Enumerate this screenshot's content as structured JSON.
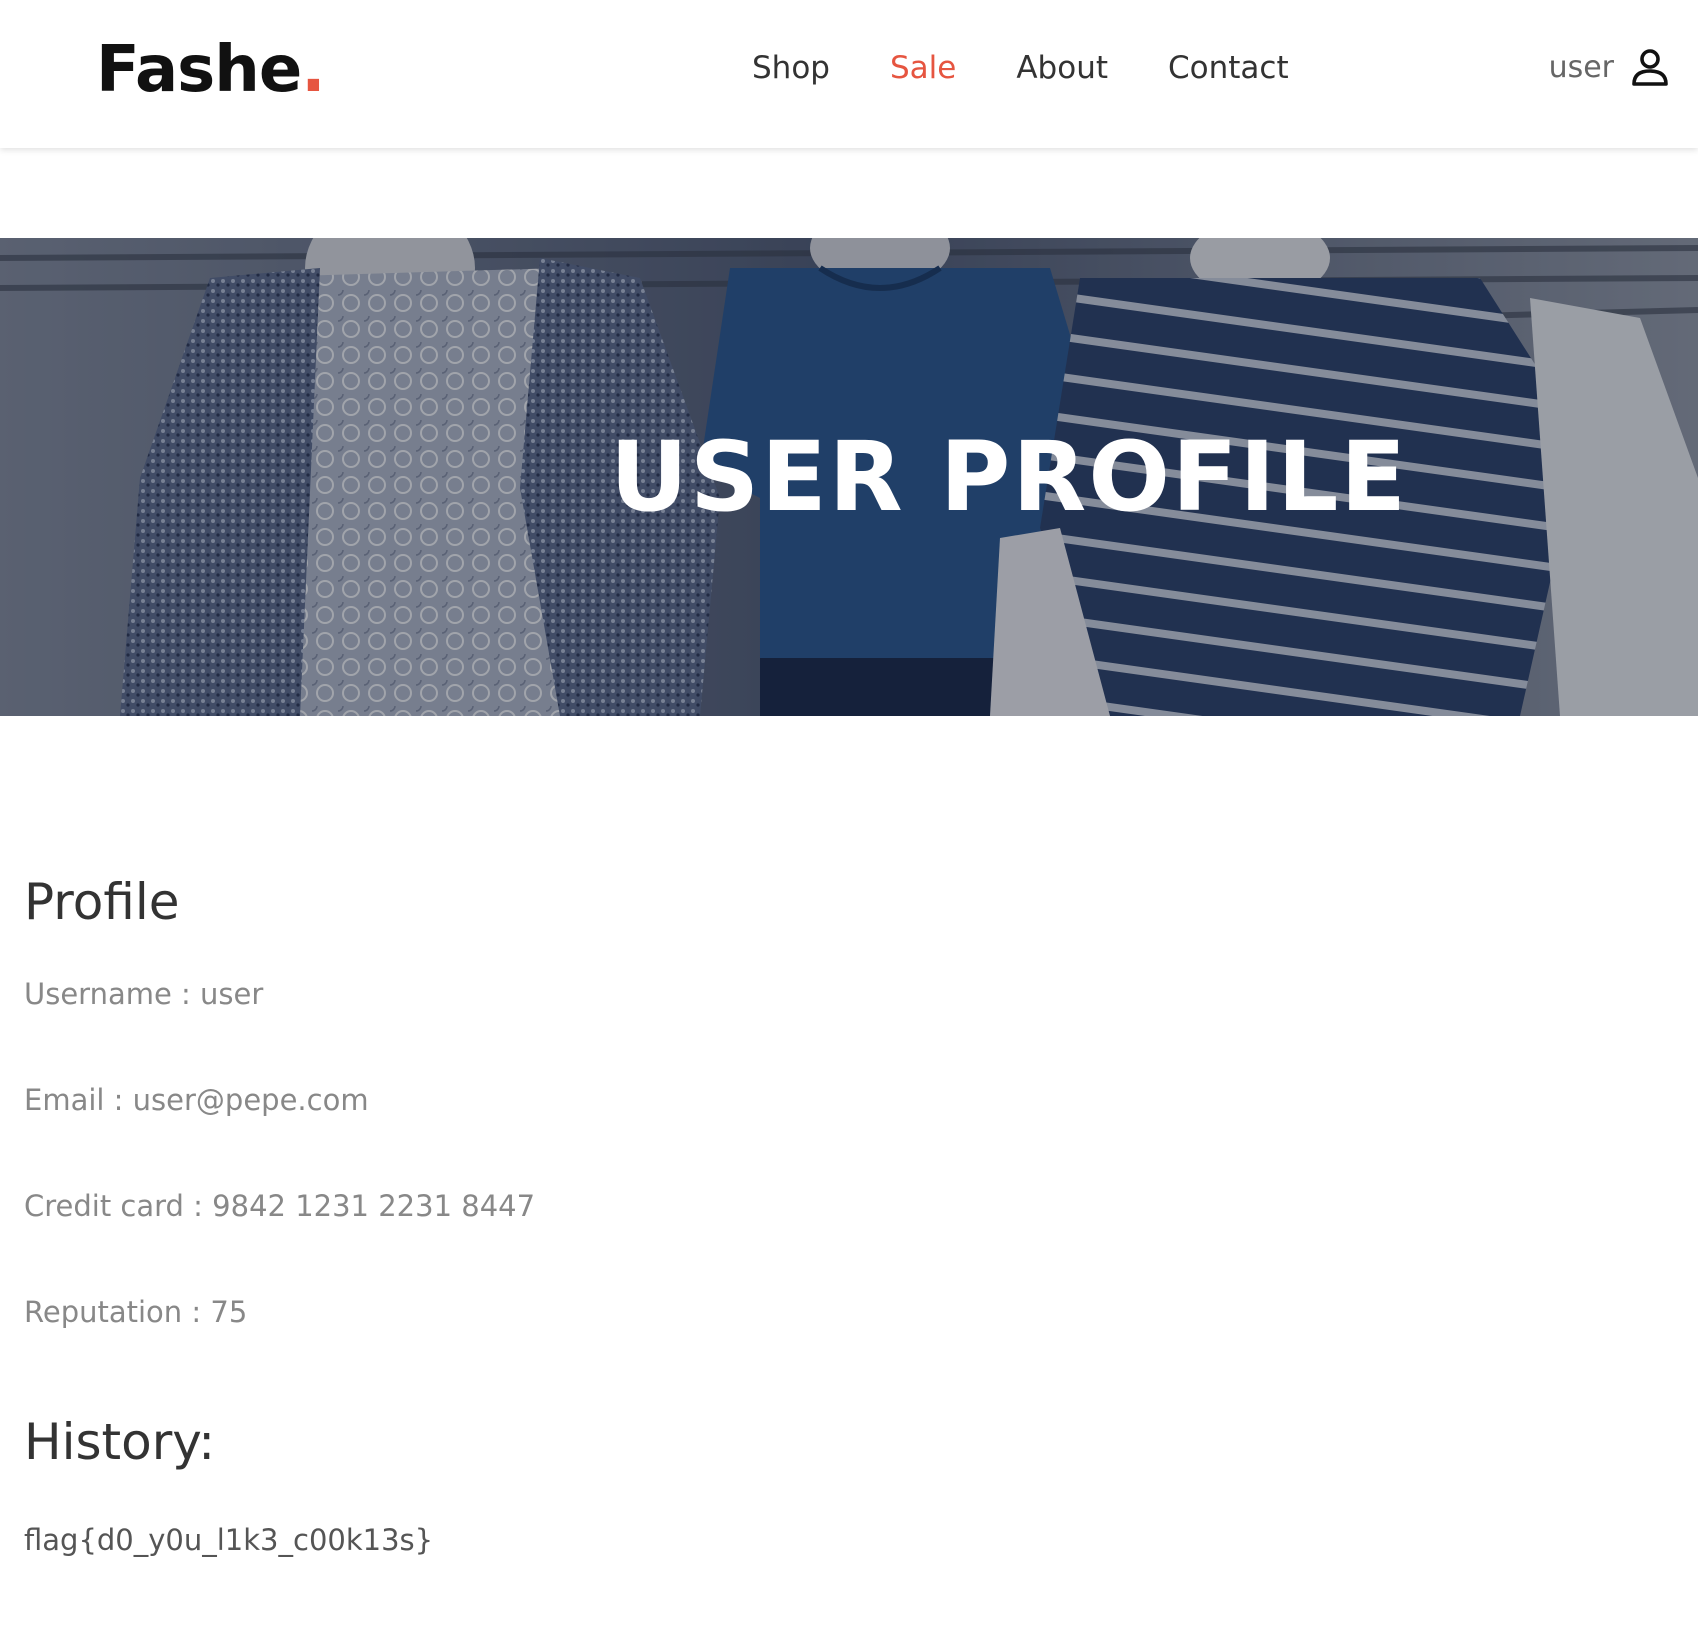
{
  "header": {
    "logo_text": "Fashe",
    "logo_dot": ".",
    "nav": {
      "shop": "Shop",
      "sale": "Sale",
      "about": "About",
      "contact": "Contact"
    },
    "account_name": "user",
    "account_icon": "user-icon"
  },
  "hero": {
    "title": "USER PROFILE"
  },
  "profile": {
    "heading": "Profile",
    "username": "Username : user",
    "email": "Email : user@pepe.com",
    "credit_card": "Credit card : 9842 1231 2231 8447",
    "reputation": "Reputation : 75"
  },
  "history": {
    "heading": "History:",
    "entry": "flag{d0_y0u_l1k3_c00k13s}"
  },
  "colors": {
    "accent": "#e65540",
    "text_dark": "#333333",
    "text_muted": "#888888"
  }
}
